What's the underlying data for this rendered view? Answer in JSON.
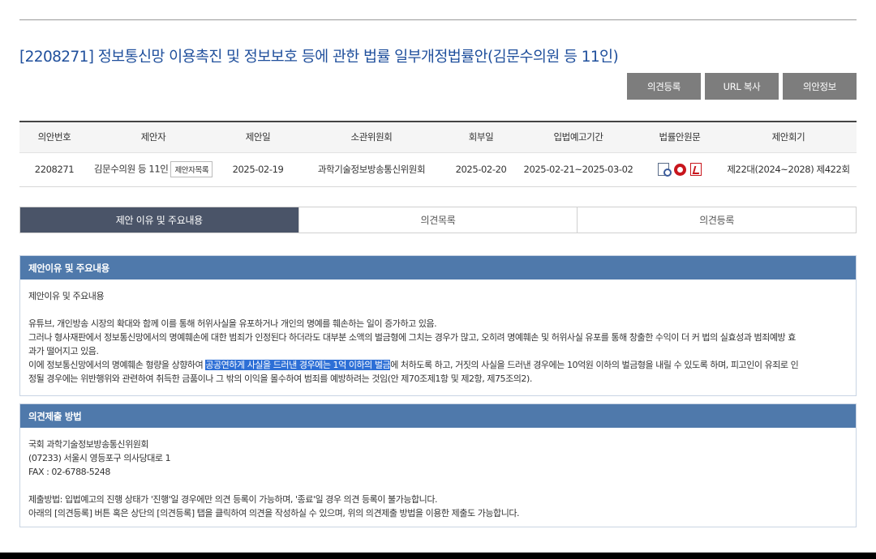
{
  "title": "[2208271] 정보통신망 이용촉진 및 정보보호 등에 관한 법률 일부개정법률안(김문수의원 등 11인)",
  "buttons": {
    "opinion_register": "의견등록",
    "url_copy": "URL 복사",
    "bill_info": "의안정보"
  },
  "info": {
    "headers": [
      "의안번호",
      "제안자",
      "제안일",
      "소관위원회",
      "회부일",
      "입법예고기간",
      "법률안원문",
      "제안회기"
    ],
    "bill_no": "2208271",
    "proposer": "김문수의원 등 11인",
    "proposer_list_btn": "제안자목록",
    "propose_date": "2025-02-19",
    "committee": "과학기술정보방송통신위원회",
    "referral_date": "2025-02-20",
    "notice_period": "2025-02-21~2025-03-02",
    "session": "제22대(2024~2028) 제422회",
    "doc_icons": [
      "document-view-icon",
      "hwp-file-icon",
      "pdf-file-icon"
    ]
  },
  "tabs": [
    "제안 이유 및 주요내용",
    "의견목록",
    "의견등록"
  ],
  "reason": {
    "heading": "제안이유 및 주요내용",
    "subtitle": "제안이유 및 주요내용",
    "p1": "유튜브, 개인방송 시장의 확대와 함께 이를 통해 허위사실을 유포하거나 개인의 명예를 훼손하는 일이 증가하고 있음.",
    "p2a": "그러나 형사재판에서 정보통신망에서의 명예훼손에 대한 범죄가 인정된다 하더라도 대부분 소액의 벌금형에 그치는 경우가 많고, 오히려 명예훼손 및 허위사실 유포를 통해 창출한 수익이 더 커 법의 실효성과 범죄예방 효",
    "p2b": "과가 떨어지고 있음.",
    "p3_before": "이에 정보통신망에서의 명예훼손 형량을 상향하여 ",
    "p3_highlight": "공공연하게 사실을 드러낸 경우에는 1억 이하의 벌금",
    "p3_after": "에 처하도록 하고, 거짓의 사실을 드러낸 경우에는 10억원 이하의 벌금형을 내릴 수 있도록 하며, 피고인이 유죄로 인",
    "p3b": "정될 경우에는 위반행위와 관련하여 취득한 금품이나 그 밖의 이익을 몰수하여 범죄를 예방하려는 것임(안 제70조제1항 및 제2항, 제75조의2)."
  },
  "submit": {
    "heading": "의견제출 방법",
    "l1": "국회 과학기술정보방송통신위원회",
    "l2": "(07233) 서울시 영등포구 의사당대로 1",
    "l3": "FAX : 02-6788-5248",
    "l4": "제출방법: 입법예고의 진행 상태가 '진행'일 경우에만 의견 등록이 가능하며, '종료'일 경우 의견 등록이 불가능합니다.",
    "l5": "아래의 [의견등록] 버튼 혹은 상단의 [의견등록] 탭을 클릭하여 의견을 작성하실 수 있으며, 위의 의견제출 방법을 이용한 제출도 가능합니다."
  }
}
